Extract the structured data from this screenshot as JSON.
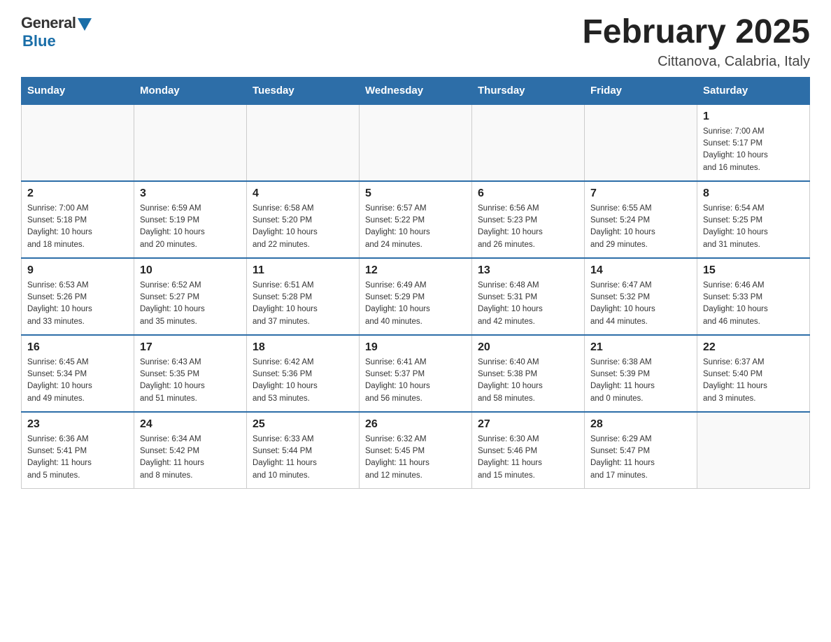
{
  "logo": {
    "general": "General",
    "blue": "Blue"
  },
  "title": "February 2025",
  "location": "Cittanova, Calabria, Italy",
  "days_of_week": [
    "Sunday",
    "Monday",
    "Tuesday",
    "Wednesday",
    "Thursday",
    "Friday",
    "Saturday"
  ],
  "weeks": [
    [
      {
        "day": "",
        "info": ""
      },
      {
        "day": "",
        "info": ""
      },
      {
        "day": "",
        "info": ""
      },
      {
        "day": "",
        "info": ""
      },
      {
        "day": "",
        "info": ""
      },
      {
        "day": "",
        "info": ""
      },
      {
        "day": "1",
        "info": "Sunrise: 7:00 AM\nSunset: 5:17 PM\nDaylight: 10 hours\nand 16 minutes."
      }
    ],
    [
      {
        "day": "2",
        "info": "Sunrise: 7:00 AM\nSunset: 5:18 PM\nDaylight: 10 hours\nand 18 minutes."
      },
      {
        "day": "3",
        "info": "Sunrise: 6:59 AM\nSunset: 5:19 PM\nDaylight: 10 hours\nand 20 minutes."
      },
      {
        "day": "4",
        "info": "Sunrise: 6:58 AM\nSunset: 5:20 PM\nDaylight: 10 hours\nand 22 minutes."
      },
      {
        "day": "5",
        "info": "Sunrise: 6:57 AM\nSunset: 5:22 PM\nDaylight: 10 hours\nand 24 minutes."
      },
      {
        "day": "6",
        "info": "Sunrise: 6:56 AM\nSunset: 5:23 PM\nDaylight: 10 hours\nand 26 minutes."
      },
      {
        "day": "7",
        "info": "Sunrise: 6:55 AM\nSunset: 5:24 PM\nDaylight: 10 hours\nand 29 minutes."
      },
      {
        "day": "8",
        "info": "Sunrise: 6:54 AM\nSunset: 5:25 PM\nDaylight: 10 hours\nand 31 minutes."
      }
    ],
    [
      {
        "day": "9",
        "info": "Sunrise: 6:53 AM\nSunset: 5:26 PM\nDaylight: 10 hours\nand 33 minutes."
      },
      {
        "day": "10",
        "info": "Sunrise: 6:52 AM\nSunset: 5:27 PM\nDaylight: 10 hours\nand 35 minutes."
      },
      {
        "day": "11",
        "info": "Sunrise: 6:51 AM\nSunset: 5:28 PM\nDaylight: 10 hours\nand 37 minutes."
      },
      {
        "day": "12",
        "info": "Sunrise: 6:49 AM\nSunset: 5:29 PM\nDaylight: 10 hours\nand 40 minutes."
      },
      {
        "day": "13",
        "info": "Sunrise: 6:48 AM\nSunset: 5:31 PM\nDaylight: 10 hours\nand 42 minutes."
      },
      {
        "day": "14",
        "info": "Sunrise: 6:47 AM\nSunset: 5:32 PM\nDaylight: 10 hours\nand 44 minutes."
      },
      {
        "day": "15",
        "info": "Sunrise: 6:46 AM\nSunset: 5:33 PM\nDaylight: 10 hours\nand 46 minutes."
      }
    ],
    [
      {
        "day": "16",
        "info": "Sunrise: 6:45 AM\nSunset: 5:34 PM\nDaylight: 10 hours\nand 49 minutes."
      },
      {
        "day": "17",
        "info": "Sunrise: 6:43 AM\nSunset: 5:35 PM\nDaylight: 10 hours\nand 51 minutes."
      },
      {
        "day": "18",
        "info": "Sunrise: 6:42 AM\nSunset: 5:36 PM\nDaylight: 10 hours\nand 53 minutes."
      },
      {
        "day": "19",
        "info": "Sunrise: 6:41 AM\nSunset: 5:37 PM\nDaylight: 10 hours\nand 56 minutes."
      },
      {
        "day": "20",
        "info": "Sunrise: 6:40 AM\nSunset: 5:38 PM\nDaylight: 10 hours\nand 58 minutes."
      },
      {
        "day": "21",
        "info": "Sunrise: 6:38 AM\nSunset: 5:39 PM\nDaylight: 11 hours\nand 0 minutes."
      },
      {
        "day": "22",
        "info": "Sunrise: 6:37 AM\nSunset: 5:40 PM\nDaylight: 11 hours\nand 3 minutes."
      }
    ],
    [
      {
        "day": "23",
        "info": "Sunrise: 6:36 AM\nSunset: 5:41 PM\nDaylight: 11 hours\nand 5 minutes."
      },
      {
        "day": "24",
        "info": "Sunrise: 6:34 AM\nSunset: 5:42 PM\nDaylight: 11 hours\nand 8 minutes."
      },
      {
        "day": "25",
        "info": "Sunrise: 6:33 AM\nSunset: 5:44 PM\nDaylight: 11 hours\nand 10 minutes."
      },
      {
        "day": "26",
        "info": "Sunrise: 6:32 AM\nSunset: 5:45 PM\nDaylight: 11 hours\nand 12 minutes."
      },
      {
        "day": "27",
        "info": "Sunrise: 6:30 AM\nSunset: 5:46 PM\nDaylight: 11 hours\nand 15 minutes."
      },
      {
        "day": "28",
        "info": "Sunrise: 6:29 AM\nSunset: 5:47 PM\nDaylight: 11 hours\nand 17 minutes."
      },
      {
        "day": "",
        "info": ""
      }
    ]
  ]
}
